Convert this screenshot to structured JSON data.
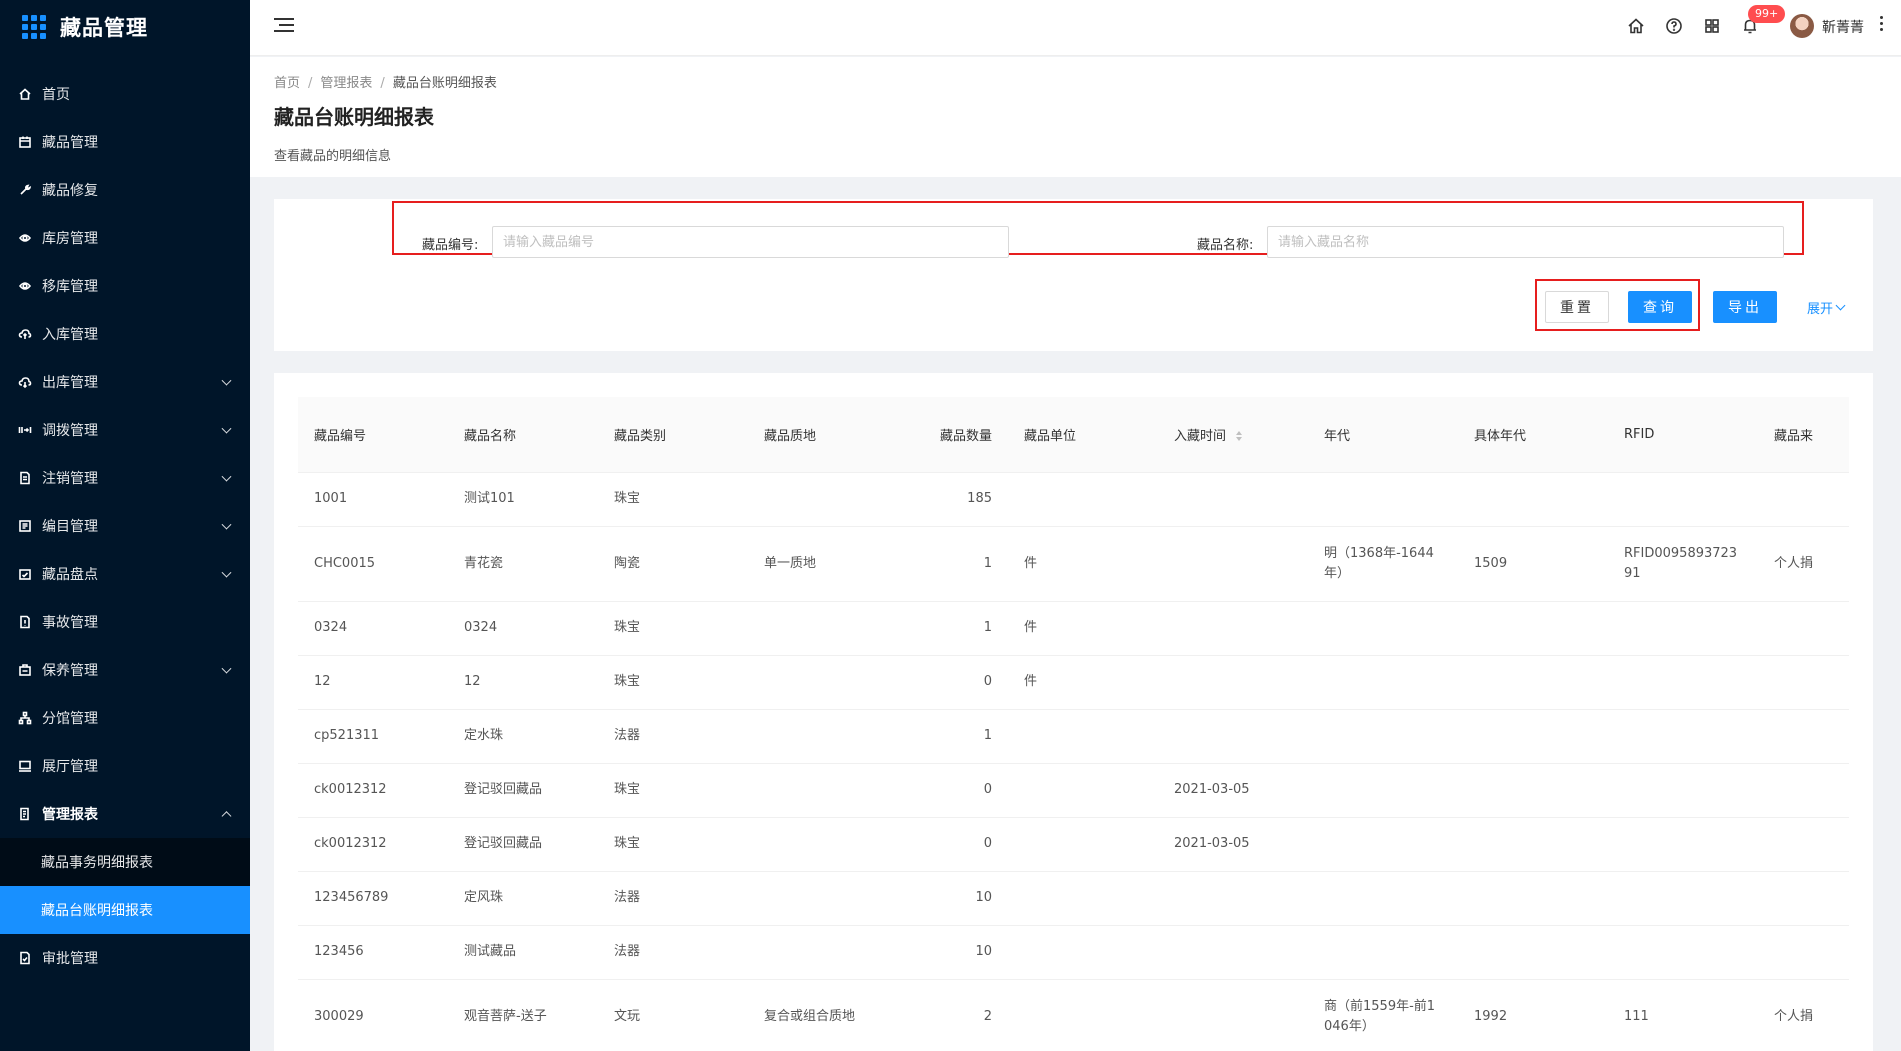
{
  "app": {
    "title": "藏品管理"
  },
  "sidebar": {
    "items": [
      {
        "label": "首页",
        "icon": "home-icon",
        "arrow": ""
      },
      {
        "label": "藏品管理",
        "icon": "calendar-icon",
        "arrow": ""
      },
      {
        "label": "藏品修复",
        "icon": "wrench-icon",
        "arrow": ""
      },
      {
        "label": "库房管理",
        "icon": "warehouse-icon",
        "arrow": ""
      },
      {
        "label": "移库管理",
        "icon": "move-icon",
        "arrow": ""
      },
      {
        "label": "入库管理",
        "icon": "cloud-upload-icon",
        "arrow": ""
      },
      {
        "label": "出库管理",
        "icon": "cloud-download-icon",
        "arrow": "down"
      },
      {
        "label": "调拨管理",
        "icon": "transfer-icon",
        "arrow": "down"
      },
      {
        "label": "注销管理",
        "icon": "file-icon",
        "arrow": "down"
      },
      {
        "label": "编目管理",
        "icon": "catalog-icon",
        "arrow": "down"
      },
      {
        "label": "藏品盘点",
        "icon": "inventory-icon",
        "arrow": "down"
      },
      {
        "label": "事故管理",
        "icon": "accident-icon",
        "arrow": ""
      },
      {
        "label": "保养管理",
        "icon": "maintain-icon",
        "arrow": "down"
      },
      {
        "label": "分馆管理",
        "icon": "branch-icon",
        "arrow": ""
      },
      {
        "label": "展厅管理",
        "icon": "monitor-icon",
        "arrow": ""
      },
      {
        "label": "管理报表",
        "icon": "report-icon",
        "arrow": "up"
      }
    ],
    "sub_items": [
      {
        "label": "藏品事务明细报表",
        "active": false
      },
      {
        "label": "藏品台账明细报表",
        "active": true
      }
    ],
    "after": [
      {
        "label": "审批管理",
        "icon": "approval-icon"
      }
    ]
  },
  "header": {
    "notification_badge": "99+",
    "username": "靳菁菁"
  },
  "page": {
    "breadcrumb": [
      "首页",
      "管理报表",
      "藏品台账明细报表"
    ],
    "title": "藏品台账明细报表",
    "description": "查看藏品的明细信息"
  },
  "search": {
    "code_label": "藏品编号:",
    "code_placeholder": "请输入藏品编号",
    "code_value": "",
    "name_label": "藏品名称:",
    "name_placeholder": "请输入藏品名称",
    "name_value": "",
    "reset_label": "重置",
    "query_label": "查询",
    "export_label": "导出",
    "expand_label": "展开"
  },
  "table": {
    "columns": [
      "藏品编号",
      "藏品名称",
      "藏品类别",
      "藏品质地",
      "藏品数量",
      "藏品单位",
      "入藏时间",
      "年代",
      "具体年代",
      "RFID",
      "藏品来"
    ],
    "rows": [
      [
        "1001",
        "测试101",
        "珠宝",
        "",
        "185",
        "",
        "",
        "",
        "",
        "",
        ""
      ],
      [
        "CHC0015",
        "青花瓷",
        "陶瓷",
        "单一质地",
        "1",
        "件",
        "",
        "明（1368年-1644年）",
        "1509",
        "RFID009589372391",
        "个人捐"
      ],
      [
        "0324",
        "0324",
        "珠宝",
        "",
        "1",
        "件",
        "",
        "",
        "",
        "",
        ""
      ],
      [
        "12",
        "12",
        "珠宝",
        "",
        "0",
        "件",
        "",
        "",
        "",
        "",
        ""
      ],
      [
        "cp521311",
        "定水珠",
        "法器",
        "",
        "1",
        "",
        "",
        "",
        "",
        "",
        ""
      ],
      [
        "ck0012312",
        "登记驳回藏品",
        "珠宝",
        "",
        "0",
        "",
        "2021-03-05",
        "",
        "",
        "",
        ""
      ],
      [
        "ck0012312",
        "登记驳回藏品",
        "珠宝",
        "",
        "0",
        "",
        "2021-03-05",
        "",
        "",
        "",
        ""
      ],
      [
        "123456789",
        "定风珠",
        "法器",
        "",
        "10",
        "",
        "",
        "",
        "",
        "",
        ""
      ],
      [
        "123456",
        "测试藏品",
        "法器",
        "",
        "10",
        "",
        "",
        "",
        "",
        "",
        ""
      ],
      [
        "300029",
        "观音菩萨-送子",
        "文玩",
        "复合或组合质地",
        "2",
        "",
        "",
        "商（前1559年-前1046年）",
        "1992",
        "111",
        "个人捐"
      ]
    ]
  }
}
